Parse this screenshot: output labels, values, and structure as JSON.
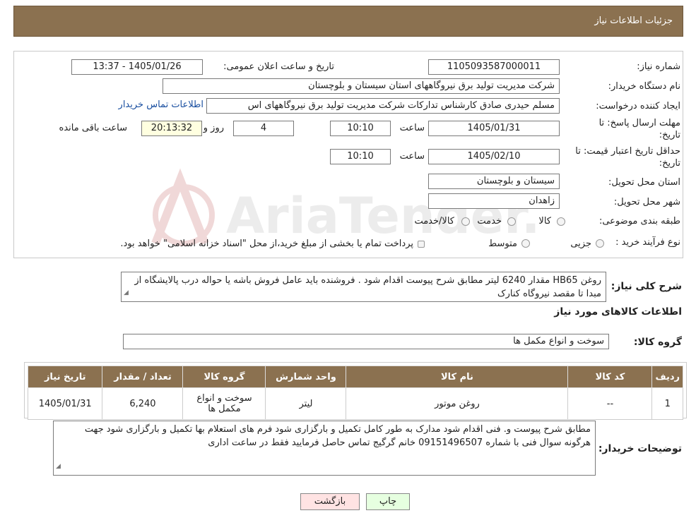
{
  "header": {
    "title": "جزئیات اطلاعات نیاز"
  },
  "form": {
    "need_number_label": "شماره نیاز:",
    "need_number": "1105093587000011",
    "announce_label": "تاریخ و ساعت اعلان عمومی:",
    "announce_value": "1405/01/26 - 13:37",
    "buyer_label": "نام دستگاه خریدار:",
    "buyer_value": "شرکت مدیریت تولید برق نیروگاههای استان سیستان و بلوچستان",
    "creator_label": "ایجاد کننده درخواست:",
    "creator_value": "مسلم حیدری صادق کارشناس تدارکات شرکت مدیریت تولید برق نیروگاههای اس",
    "contact_link": "اطلاعات تماس خریدار",
    "deadline_label_1": "مهلت ارسال پاسخ: تا",
    "deadline_label_2": "تاریخ:",
    "deadline_date": "1405/01/31",
    "time_label": "ساعت",
    "deadline_time": "10:10",
    "days_value": "4",
    "days_label": "روز و",
    "remaining_time": "20:13:32",
    "remaining_label": "ساعت باقی مانده",
    "validity_label_1": "حداقل تاریخ اعتبار قیمت: تا",
    "validity_label_2": "تاریخ:",
    "validity_date": "1405/02/10",
    "validity_time": "10:10",
    "province_label": "استان محل تحویل:",
    "province_value": "سیستان و بلوچستان",
    "city_label": "شهر محل تحویل:",
    "city_value": "زاهدان",
    "category_label": "طبقه بندی موضوعی:",
    "category_options": [
      "کالا",
      "خدمت",
      "کالا/خدمت"
    ],
    "process_label": "نوع فرآیند خرید :",
    "process_options": [
      "جزیی",
      "متوسط"
    ],
    "process_note": "پرداخت تمام یا بخشی از مبلغ خرید،از محل \"اسناد خزانه اسلامی\" خواهد بود."
  },
  "summary": {
    "label": "شرح کلی نیاز:",
    "text": "روغن HB65 مقدار  6240 لیتر  مطابق شرح پیوست اقدام شود . فروشنده باید عامل فروش باشه یا حواله درب پالایشگاه از مبدا تا مقصد نیروگاه کنارک"
  },
  "goods": {
    "section_title": "اطلاعات کالاهای مورد نیاز",
    "group_label": "گروه کالا:",
    "group_value": "سوخت و انواع مکمل ها",
    "columns": [
      "ردیف",
      "کد کالا",
      "نام کالا",
      "واحد شمارش",
      "گروه کالا",
      "تعداد / مقدار",
      "تاریخ نیاز"
    ],
    "rows": [
      [
        "1",
        "--",
        "روغن موتور",
        "لیتر",
        "سوخت و انواع مکمل ها",
        "6,240",
        "1405/01/31"
      ]
    ]
  },
  "buyer_notes": {
    "label": "توضیحات خریدار:",
    "text": "مطابق شرح پیوست و. فنی اقدام شود مدارک به طور کامل تکمیل و بارگزاری شود فرم های استعلام بها تکمیل و بارگزاری شود جهت هرگونه سوال فنی با شماره 09151496507 خانم گرگیج تماس حاصل فرمایید فقط در ساعت اداری"
  },
  "buttons": {
    "print": "چاپ",
    "back": "بازگشت"
  },
  "watermark": {
    "text": "AriaTender.neT"
  },
  "colors": {
    "header_bg": "#8b7150",
    "link": "#1a4fa0",
    "back_button_bg": "#ffe3e3",
    "print_button_bg": "#e6ffe0"
  }
}
